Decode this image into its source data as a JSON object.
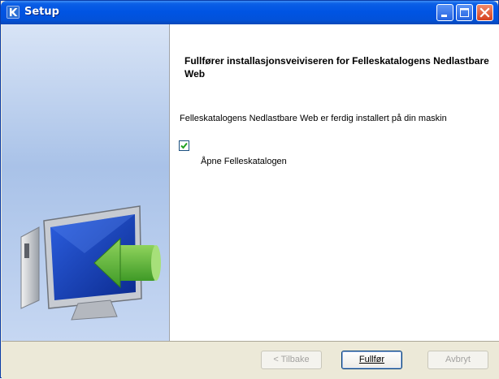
{
  "window": {
    "title": "Setup"
  },
  "main": {
    "heading": "Fullfører installasjonsveiviseren for Felleskatalogens Nedlastbare Web",
    "body": "Felleskatalogens Nedlastbare Web er ferdig installert på din maskin",
    "checkbox_label": "Åpne Felleskatalogen",
    "checkbox_checked": true
  },
  "footer": {
    "back_label": "< Tilbake",
    "finish_label": "Fullfør",
    "cancel_label": "Avbryt"
  },
  "colors": {
    "titlebar": "#0054e3",
    "sidepanel": "#a9c2e8",
    "arrow": "#5cae36",
    "monitor_screen": "#1a3fb0"
  }
}
